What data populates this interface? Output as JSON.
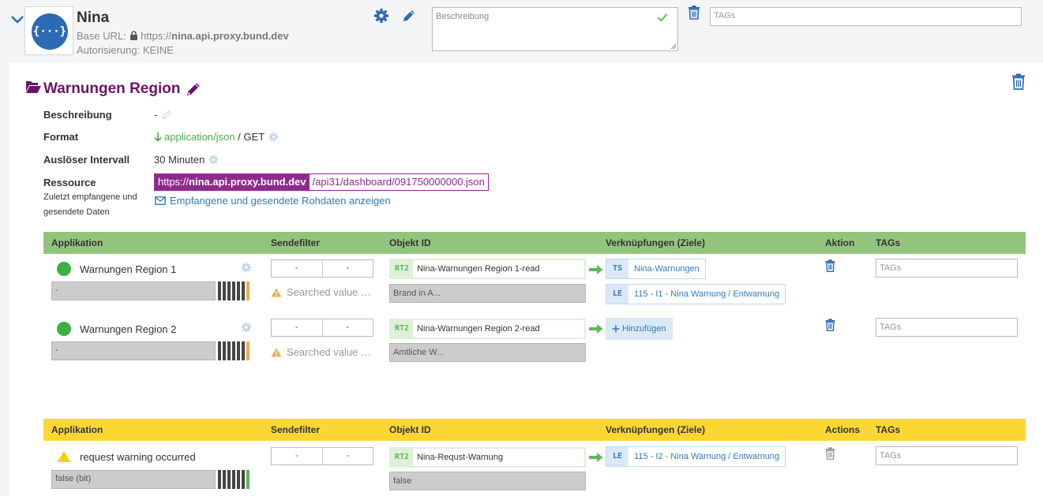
{
  "header": {
    "title": "Nina",
    "logo_text": "{···}",
    "base_url_label": "Base URL:",
    "base_url_scheme": "https://",
    "base_url_host": "nina.api.proxy.bund.dev",
    "auth_text": "Autorisierung: KEINE",
    "description_placeholder": "Beschreibung",
    "tags_placeholder": "TAGs"
  },
  "section": {
    "title": "Warnungen Region",
    "fields": {
      "beschreibung_label": "Beschreibung",
      "beschreibung_value": "-",
      "format_label": "Format",
      "format_type": "application/json",
      "format_method": " / GET",
      "intervall_label": "Auslöser Intervall",
      "intervall_value": "30 Minuten",
      "ressource_label": "Ressource",
      "ressource_sub": "Zuletzt empfangene und gesendete Daten",
      "ressource_scheme": "https://",
      "ressource_host": "nina.api.proxy.bund.dev",
      "ressource_path": "/api31/dashboard/091750000000.json",
      "raw_link": "Empfangene und gesendete Rohdaten anzeigen"
    }
  },
  "table1": {
    "header_color": "#93c47d",
    "headers": [
      "Applikation",
      "Sendefilter",
      "Objekt ID",
      "Verknüpfungen (Ziele)",
      "Aktion",
      "TAGs"
    ],
    "rows": [
      {
        "name": "Warnungen Region 1",
        "value": "-",
        "filter_a": "-",
        "filter_b": "-",
        "filter_warning": "Searched value …",
        "obj_tag": "RT2",
        "obj_name": "Nina-Warnungen Region 1-read",
        "obj_value": "Brand in A...",
        "links": [
          {
            "tag": "TS",
            "text": "Nina-Warnungen"
          },
          {
            "tag": "LE",
            "text": "115 - I1 - Nina Warnung / Entwarnung"
          }
        ],
        "tags_placeholder": "TAGs"
      },
      {
        "name": "Warnungen Region 2",
        "value": "-",
        "filter_a": "-",
        "filter_b": "-",
        "filter_warning": "Searched value …",
        "obj_tag": "RT2",
        "obj_name": "Nina-Warnungen Region 2-read",
        "obj_value": "Amtliche W...",
        "add_label": "Hinzufügen",
        "tags_placeholder": "TAGs"
      }
    ]
  },
  "table2": {
    "header_color": "#fcd734",
    "headers": [
      "Applikation",
      "Sendefilter",
      "Objekt ID",
      "Verknüpfungen (Ziele)",
      "Actions",
      "TAGs"
    ],
    "rows": [
      {
        "name": "request warning occurred",
        "value": "false (bit)",
        "filter_a": "-",
        "filter_b": "-",
        "obj_tag": "RT2",
        "obj_name": "Nina-Requst-Warnung",
        "obj_value": "false",
        "links": [
          {
            "tag": "LE",
            "text": "115 - I2 - Nina Warnung / Entwarnung"
          }
        ],
        "tags_placeholder": "TAGs"
      }
    ]
  },
  "colors": {
    "purple": "#6a1567",
    "link_blue": "#337ab7",
    "green": "#5cb85c",
    "warn_orange": "#f0ad4e"
  }
}
